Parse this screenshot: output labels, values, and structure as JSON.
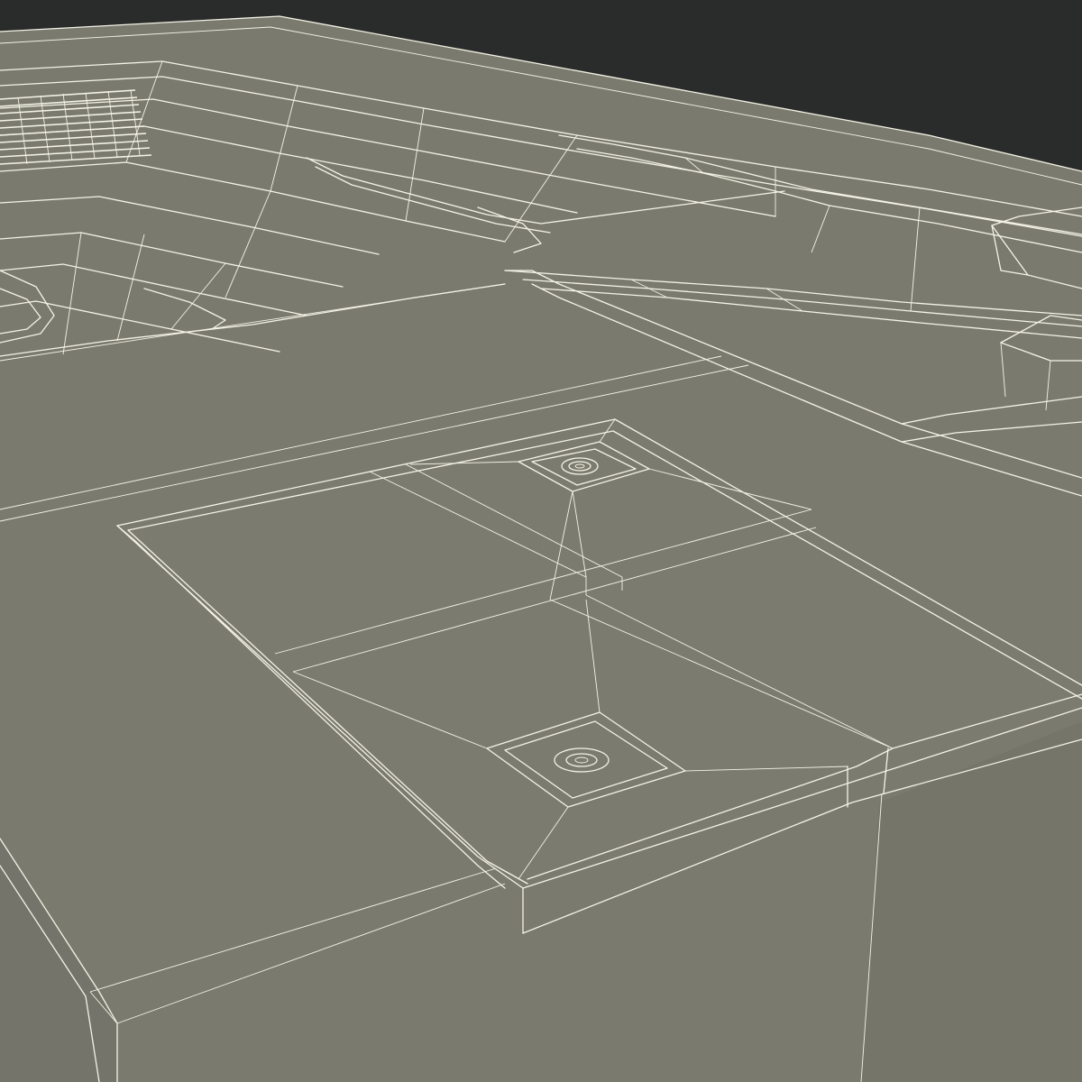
{
  "scene": {
    "background_color": "#2a2b2b",
    "surface_color": "#7a7a6e",
    "surface_shadow_color": "#6f6f64",
    "wire_color": "#f4f3e6",
    "render_mode": "wireframe-on-shaded"
  }
}
